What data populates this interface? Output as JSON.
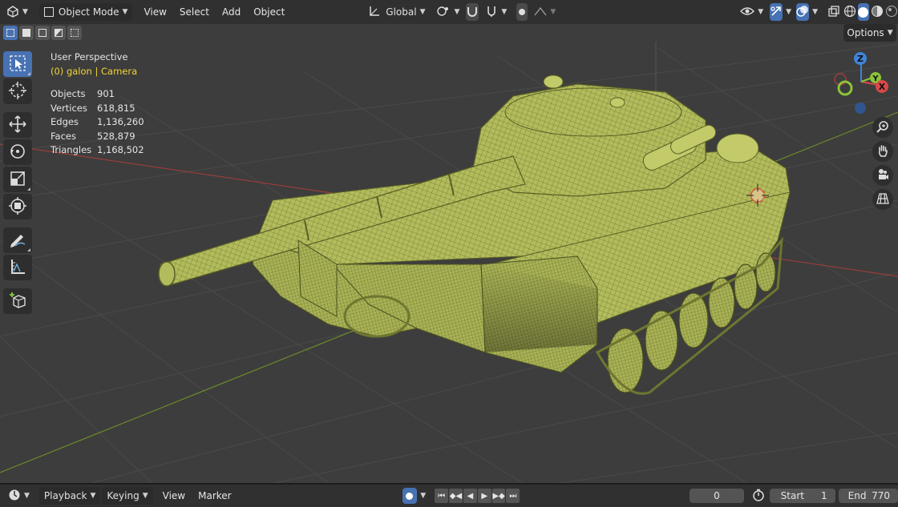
{
  "header": {
    "editor_type_icon": "viewport-editor-icon",
    "mode": "Object Mode",
    "menus": [
      "View",
      "Select",
      "Add",
      "Object"
    ],
    "transform_orientation": "Global",
    "options_label": "Options"
  },
  "overlay": {
    "view_name": "User Perspective",
    "object_label": "(0) galon | Camera",
    "stats": [
      {
        "label": "Objects",
        "value": "901"
      },
      {
        "label": "Vertices",
        "value": "618,815"
      },
      {
        "label": "Edges",
        "value": "1,136,260"
      },
      {
        "label": "Faces",
        "value": "528,879"
      },
      {
        "label": "Triangles",
        "value": "1,168,502"
      }
    ]
  },
  "gizmo": {
    "x": "X",
    "y": "Y",
    "z": "Z"
  },
  "timeline": {
    "menus": [
      "Playback",
      "Keying",
      "View",
      "Marker"
    ],
    "current_frame": "0",
    "start_label": "Start",
    "start_value": "1",
    "end_label": "End",
    "end_value": "770"
  },
  "colors": {
    "accent": "#4772b3",
    "header_bg": "#303030",
    "viewport_bg": "#3d3d3d",
    "info_highlight": "#f2d437",
    "model_green": "#b9c160",
    "axis_x": "#d94848",
    "axis_y": "#8cc43a",
    "axis_z": "#3f84d9"
  }
}
